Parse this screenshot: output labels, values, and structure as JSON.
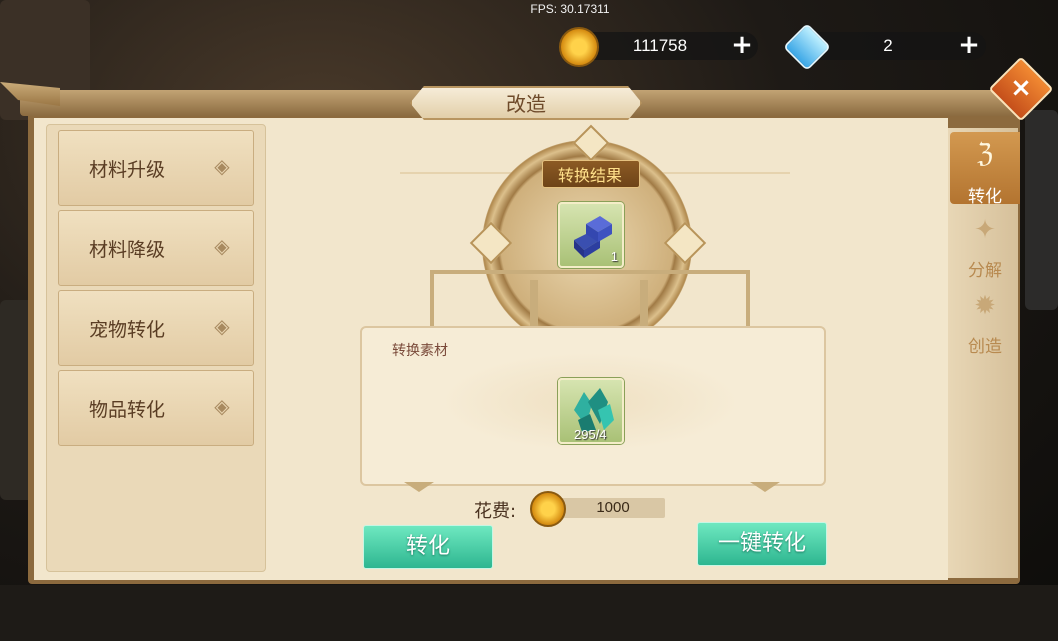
{
  "hud": {
    "fps": "FPS: 30.17311",
    "gold_value": "111758",
    "diamond_value": "2",
    "plus_label": "+"
  },
  "dialog": {
    "title": "改造",
    "close_label": "×"
  },
  "menu": {
    "items": [
      {
        "label": "材料升级"
      },
      {
        "label": "材料降级"
      },
      {
        "label": "宠物转化"
      },
      {
        "label": "物品转化"
      }
    ]
  },
  "result": {
    "label": "转换结果",
    "count": "1"
  },
  "material": {
    "label": "转换素材",
    "count": "295/4"
  },
  "cost": {
    "label": "花费:",
    "value": "1000"
  },
  "buttons": {
    "convert": "转化",
    "convert_all": "一键转化"
  },
  "side_tabs": [
    {
      "label": "转化",
      "icon": "rune-icon",
      "active": true
    },
    {
      "label": "分解",
      "icon": "decompose-icon",
      "active": false
    },
    {
      "label": "创造",
      "icon": "gear-icon",
      "active": false
    }
  ],
  "colors": {
    "accent_green": "#2eb690",
    "panel_brown": "#8c6a3e",
    "parchment": "#f2e6cc",
    "active_tab": "#c58a40"
  }
}
